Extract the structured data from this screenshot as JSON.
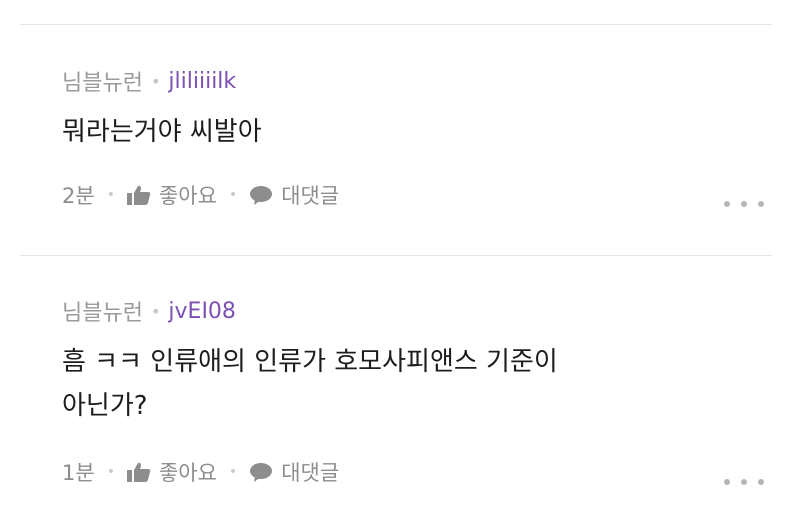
{
  "comments": [
    {
      "nickname": "님블뉴런",
      "username": "jliliiiilk",
      "text_lines": [
        "뭐라는거야 씨발아"
      ],
      "time": "2분",
      "like_label": "좋아요",
      "reply_label": "대댓글"
    },
    {
      "nickname": "님블뉴런",
      "username": "jvEI08",
      "text_lines": [
        "흠 ㅋㅋ 인류애의 인류가 호모사피앤스 기준이",
        "아닌가?"
      ],
      "time": "1분",
      "like_label": "좋아요",
      "reply_label": "대댓글"
    }
  ],
  "colors": {
    "username": "#7b51b3",
    "meta": "#9a9a9a",
    "text": "#1d1d1d",
    "divider": "#e4e4e4"
  },
  "icons": [
    "thumbs-up-icon",
    "speech-bubble-icon",
    "more-dots-icon"
  ]
}
